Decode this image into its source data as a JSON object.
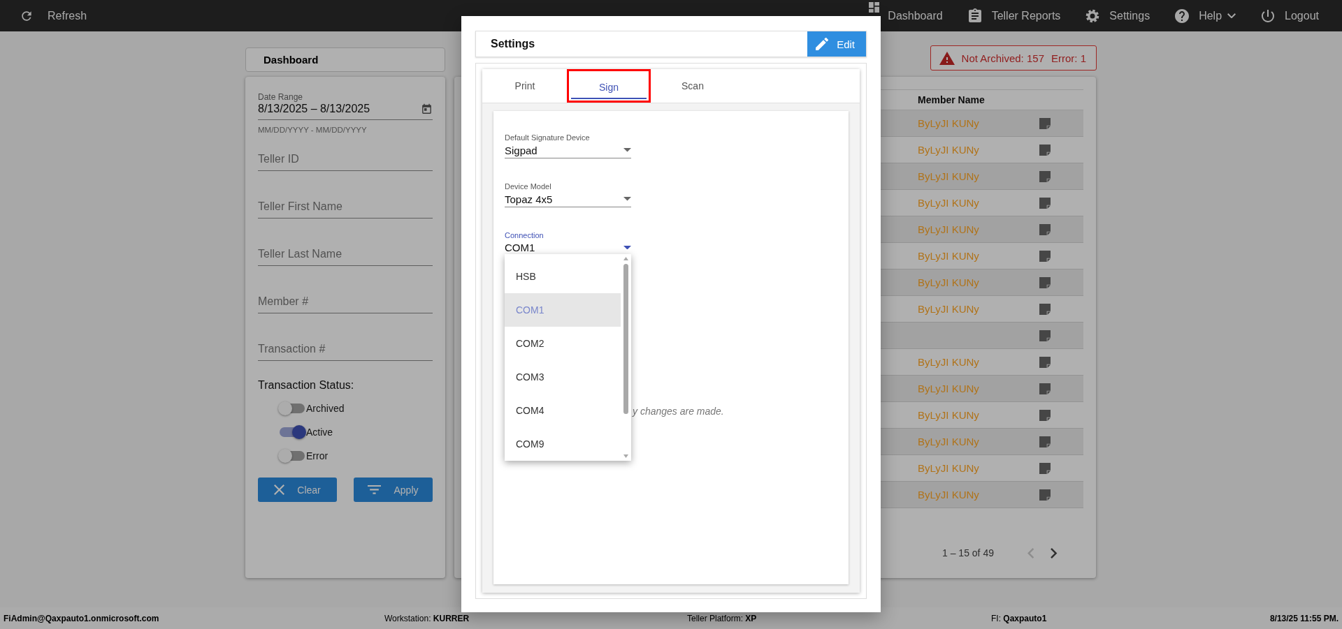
{
  "top_bar": {
    "refresh": "Refresh",
    "nav": [
      {
        "label": "Dashboard",
        "kind": "dashboard",
        "has_menu": false
      },
      {
        "label": "Teller Reports",
        "kind": "reports",
        "has_menu": false
      },
      {
        "label": "Settings",
        "kind": "settings",
        "has_menu": false
      },
      {
        "label": "Help",
        "kind": "help",
        "has_menu": true
      },
      {
        "label": "Logout",
        "kind": "logout",
        "has_menu": false
      }
    ]
  },
  "dashboard_panel": {
    "title": "Dashboard"
  },
  "filters": {
    "date_range": {
      "label": "Date Range",
      "value": "8/13/2025 – 8/13/2025",
      "hint": "MM/DD/YYYY - MM/DD/YYYY"
    },
    "fields": [
      {
        "placeholder": "Teller ID"
      },
      {
        "placeholder": "Teller First Name"
      },
      {
        "placeholder": "Teller Last Name"
      },
      {
        "placeholder": "Member #"
      },
      {
        "placeholder": "Transaction #"
      }
    ],
    "status_label": "Transaction Status:",
    "statuses": [
      {
        "label": "Archived",
        "on": false
      },
      {
        "label": "Active",
        "on": true
      },
      {
        "label": "Error",
        "on": false
      }
    ],
    "buttons": [
      {
        "label": "Clear",
        "kind": "clear"
      },
      {
        "label": "Apply",
        "kind": "apply"
      }
    ]
  },
  "alert": {
    "not_archived": "Not Archived: 157",
    "error": "Error: 1"
  },
  "table": {
    "columns": [
      "Member Name"
    ],
    "rows": [
      {
        "member_name": "ByLyJI KUNy"
      },
      {
        "member_name": "ByLyJI KUNy"
      },
      {
        "member_name": "ByLyJI KUNy"
      },
      {
        "member_name": "ByLyJI KUNy"
      },
      {
        "member_name": "ByLyJI KUNy"
      },
      {
        "member_name": "ByLyJI KUNy"
      },
      {
        "member_name": "ByLyJI KUNy"
      },
      {
        "member_name": "ByLyJI KUNy"
      },
      {},
      {
        "member_name": "ByLyJI KUNy"
      },
      {
        "member_name": "ByLyJI KUNy"
      },
      {
        "member_name": "ByLyJI KUNy"
      },
      {
        "member_name": "ByLyJI KUNy"
      },
      {
        "member_name": "ByLyJI KUNy"
      },
      {
        "member_name": "ByLyJI KUNy"
      }
    ]
  },
  "pagination": {
    "range": "1 – 15 of 49",
    "prev_disabled": true
  },
  "settings_dialog": {
    "title": "Settings",
    "edit_button": "Edit",
    "tabs": [
      {
        "label": "Print",
        "selected": false,
        "outlined": false
      },
      {
        "label": "Sign",
        "selected": true,
        "outlined": true
      },
      {
        "label": "Scan",
        "selected": false,
        "outlined": false
      }
    ],
    "fields": [
      {
        "label": "Default Signature Device",
        "value": "Sigpad",
        "focused": false
      },
      {
        "label": "Device Model",
        "value": "Topaz 4x5",
        "focused": false
      },
      {
        "label": "Connection",
        "value": "COM1",
        "focused": true
      }
    ],
    "dropdown": {
      "options": [
        {
          "label": "HSB",
          "selected": false
        },
        {
          "label": "COM1",
          "selected": true
        },
        {
          "label": "COM2",
          "selected": false
        },
        {
          "label": "COM3",
          "selected": false
        },
        {
          "label": "COM4",
          "selected": false
        },
        {
          "label": "COM9",
          "selected": false
        }
      ]
    },
    "note": "y changes are made."
  },
  "status_bar": {
    "user": "FiAdmin@Qaxpauto1.onmicrosoft.com",
    "items": [
      {
        "label": "Workstation:",
        "value": "KURRER"
      },
      {
        "label": "Teller Platform:",
        "value": "XP"
      },
      {
        "label": "FI:",
        "value": "Qaxpauto1"
      }
    ],
    "datetime": "8/13/25 11:55 PM."
  }
}
